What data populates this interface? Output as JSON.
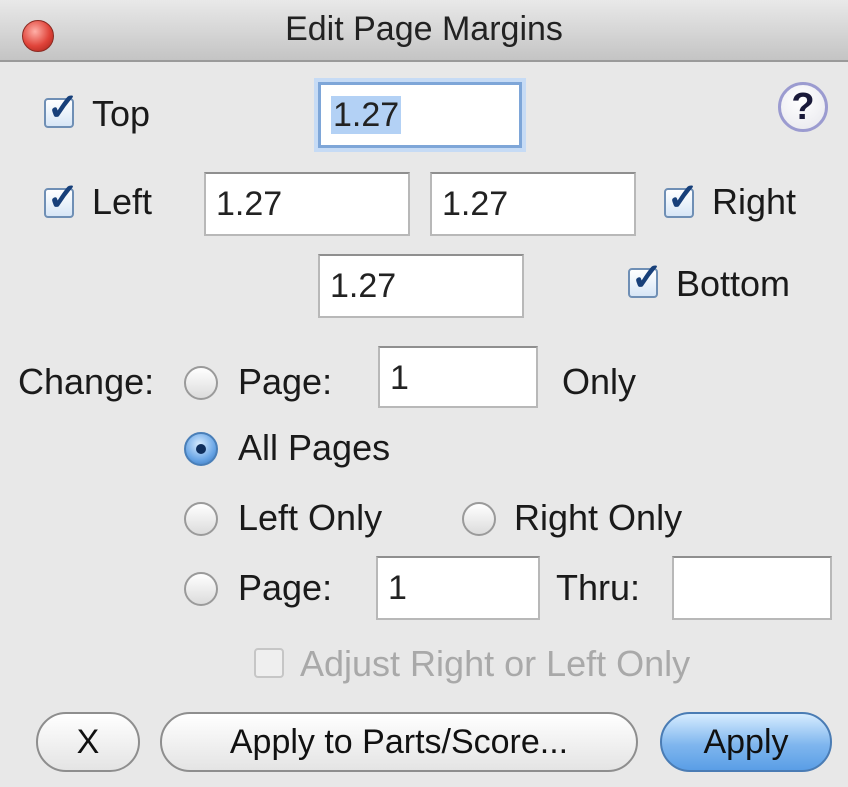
{
  "window": {
    "title": "Edit Page Margins"
  },
  "margins": {
    "top": {
      "label": "Top",
      "value": "1.27",
      "checked": true
    },
    "left": {
      "label": "Left",
      "value": "1.27",
      "checked": true
    },
    "right": {
      "label": "Right",
      "value": "1.27",
      "checked": true
    },
    "bottom": {
      "label": "Bottom",
      "value": "1.27",
      "checked": true
    }
  },
  "help": {
    "glyph": "?"
  },
  "change": {
    "label": "Change:",
    "page_label": "Page:",
    "page_value": "1",
    "only_label": "Only",
    "all_pages_label": "All Pages",
    "left_only_label": "Left Only",
    "right_only_label": "Right Only",
    "range_page_label": "Page:",
    "range_from_value": "1",
    "thru_label": "Thru:",
    "thru_value": "",
    "selected": "all_pages",
    "adjust_label": "Adjust Right or Left Only",
    "adjust_checked": false,
    "adjust_enabled": false
  },
  "buttons": {
    "close": "X",
    "apply_parts": "Apply to Parts/Score...",
    "apply": "Apply"
  },
  "colors": {
    "focus": "#7ea6d8",
    "default_button": "#7fb6ee",
    "close_button": "#e0443a"
  }
}
